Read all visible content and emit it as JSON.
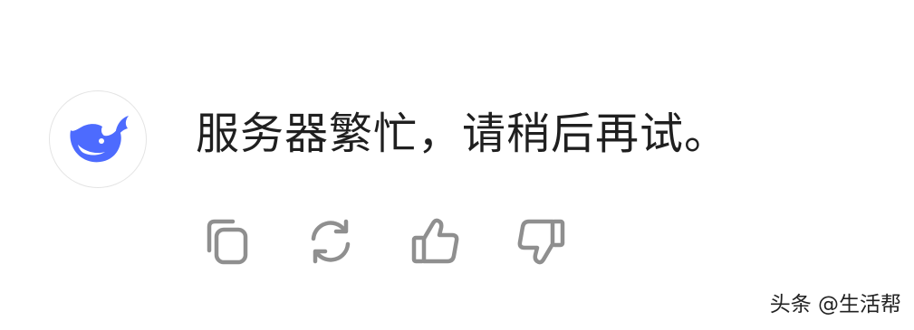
{
  "assistant": {
    "avatar_icon": "whale-logo-icon",
    "brand_color": "#4d6bfe"
  },
  "message": {
    "text": "服务器繁忙，请稍后再试。"
  },
  "actions": {
    "icon_color": "#8f8f8f",
    "items": [
      {
        "icon": "copy-icon"
      },
      {
        "icon": "regenerate-icon"
      },
      {
        "icon": "thumbs-up-icon"
      },
      {
        "icon": "thumbs-down-icon"
      }
    ]
  },
  "watermark": {
    "text": "头条 @生活帮"
  }
}
